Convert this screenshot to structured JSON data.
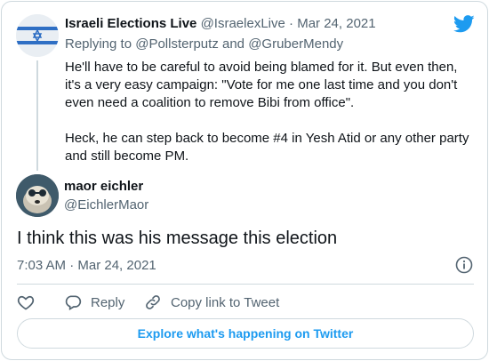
{
  "parent_tweet": {
    "name": "Israeli Elections Live",
    "handle": "@IsraelexLive",
    "separator": "·",
    "date": "Mar 24, 2021",
    "replying_prefix": "Replying to",
    "replying_user1": "@Pollsterputz",
    "replying_and": "and",
    "replying_user2": "@GruberMendy",
    "text": "He'll have to be careful to avoid being blamed for it. But even then, it's a very easy campaign: \"Vote for me one last time and you don't even need a coalition to remove Bibi from office\".\n\nHeck, he can step back to become #4 in Yesh Atid or any other party and still become PM."
  },
  "main_tweet": {
    "name": "maor eichler",
    "handle": "@EichlerMaor",
    "text": "I think this was his message this election",
    "time": "7:03 AM · Mar 24, 2021"
  },
  "actions": {
    "reply_label": "Reply",
    "copy_label": "Copy link to Tweet"
  },
  "explore_label": "Explore what's happening on Twitter",
  "colors": {
    "accent": "#1d9bf0",
    "text": "#0f1419",
    "secondary": "#536471",
    "border": "#cfd9de"
  }
}
